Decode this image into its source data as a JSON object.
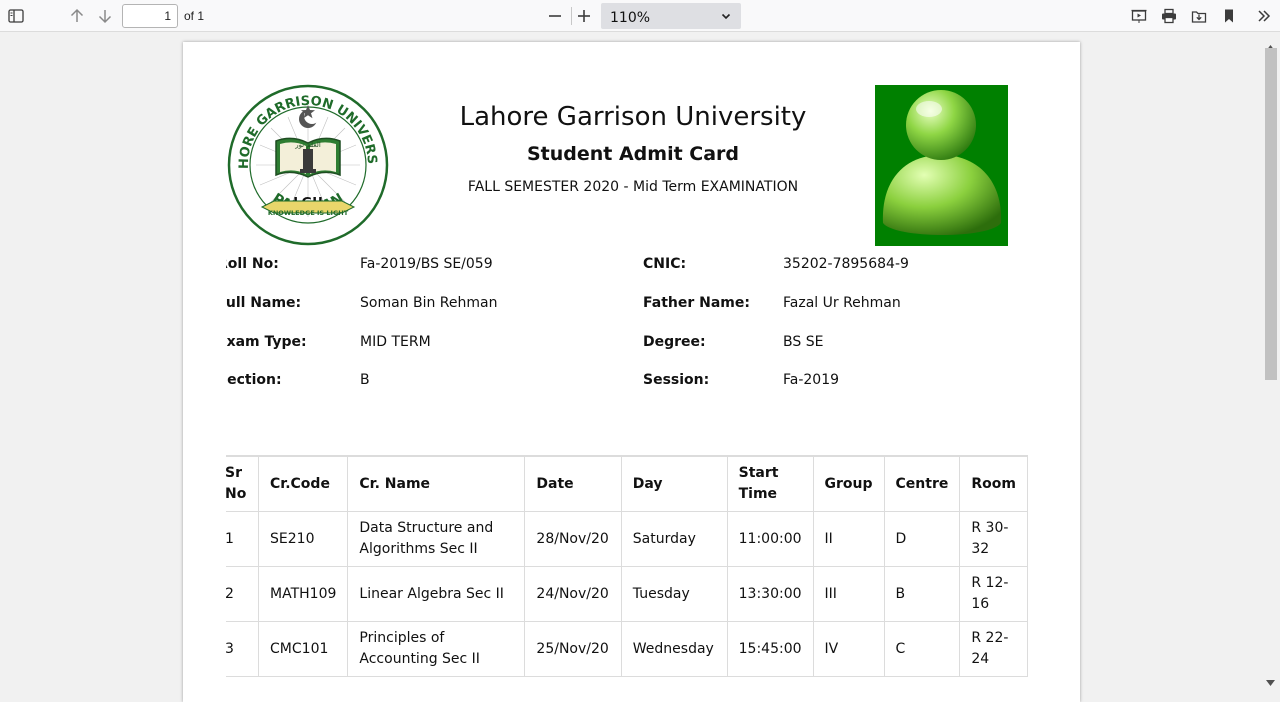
{
  "toolbar": {
    "page_current": "1",
    "page_total_label": "of 1",
    "zoom_value": "110%"
  },
  "header": {
    "university": "Lahore Garrison University",
    "card_title": "Student Admit Card",
    "semester": "FALL SEMESTER 2020 - Mid Term EXAMINATION"
  },
  "logo": {
    "ring_text": "LAHORE GARRISON UNIVERSITY",
    "bottom_text": "PAKISTAN",
    "center_text": "LGU",
    "motto": "KNOWLEDGE IS LIGHT",
    "urdu_text": "العلم نور"
  },
  "colors": {
    "logo_green": "#1f6b2a",
    "photo_bg": "#008000"
  },
  "student": {
    "roll_label": "Roll No:",
    "roll": "Fa-2019/BS SE/059",
    "cnic_label": "CNIC:",
    "cnic": "35202-7895684-9",
    "name_label": "Full Name:",
    "name": "Soman Bin Rehman",
    "father_label": "Father Name:",
    "father": "Fazal Ur Rehman",
    "exam_type_label": "Exam Type:",
    "exam_type": "MID TERM",
    "degree_label": "Degree:",
    "degree": "BS SE",
    "section_label": "Section:",
    "section": "B",
    "session_label": "Session:",
    "session": "Fa-2019"
  },
  "table": {
    "headers": [
      "Sr No",
      "Cr.Code",
      "Cr. Name",
      "Date",
      "Day",
      "Start Time",
      "Group",
      "Centre",
      "Room"
    ],
    "rows": [
      [
        "1",
        "SE210",
        "Data Structure and Algorithms Sec II",
        "28/Nov/20",
        "Saturday",
        "11:00:00",
        "II",
        "D",
        "R 30-32"
      ],
      [
        "2",
        "MATH109",
        "Linear Algebra Sec II",
        "24/Nov/20",
        "Tuesday",
        "13:30:00",
        "III",
        "B",
        "R 12-16"
      ],
      [
        "3",
        "CMC101",
        "Principles of Accounting Sec II",
        "25/Nov/20",
        "Wednesday",
        "15:45:00",
        "IV",
        "C",
        "R 22-24"
      ]
    ]
  }
}
